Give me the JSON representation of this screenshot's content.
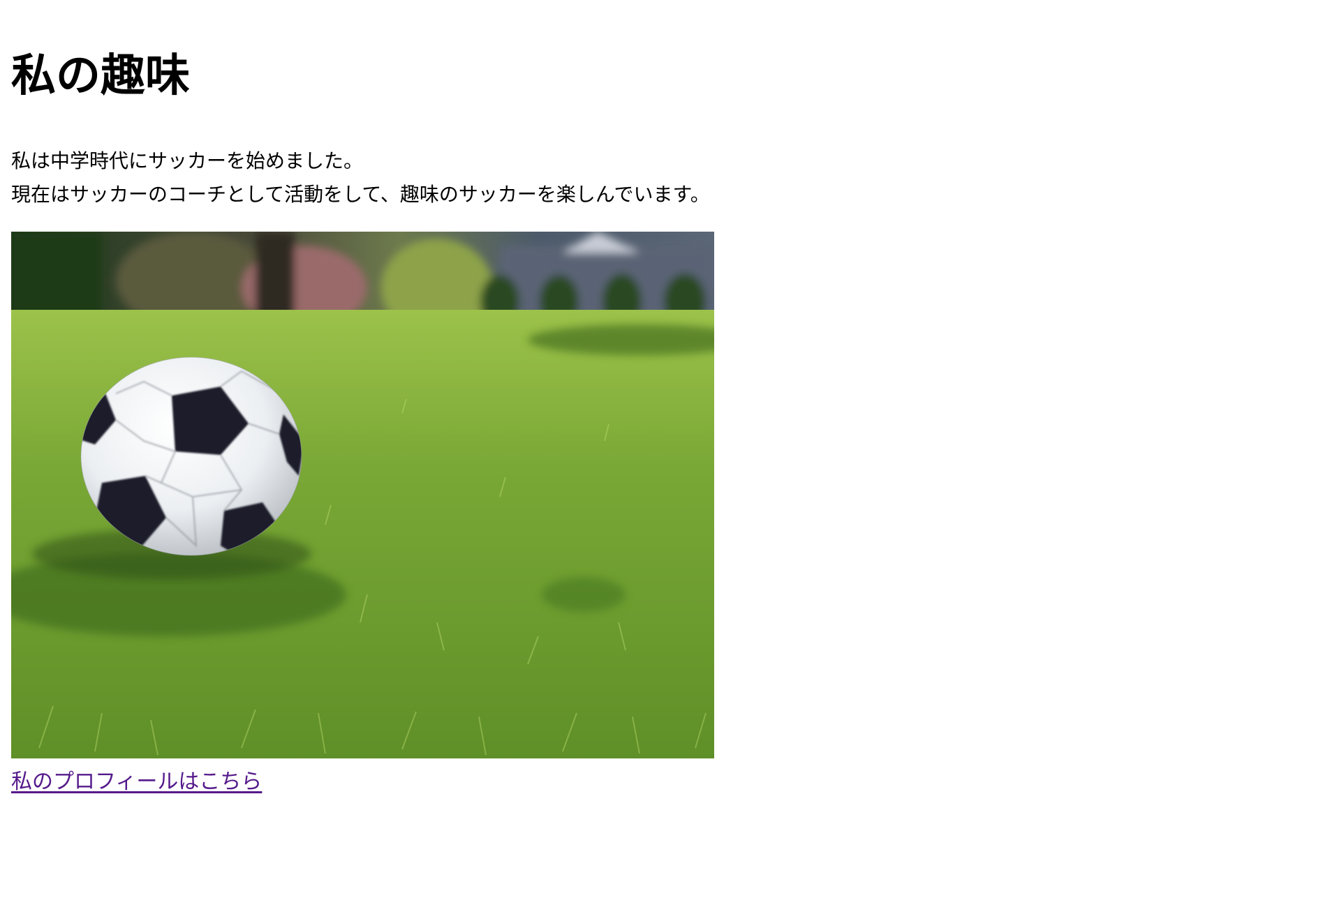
{
  "page": {
    "title": "私の趣味"
  },
  "intro": {
    "line1": "私は中学時代にサッカーを始めました。",
    "line2": "現在はサッカーのコーチとして活動をして、趣味のサッカーを楽しんでいます。"
  },
  "photo": {
    "subject": "soccer-ball-on-grass"
  },
  "link": {
    "label": "私のプロフィールはこちら",
    "color": "#551a8b"
  }
}
